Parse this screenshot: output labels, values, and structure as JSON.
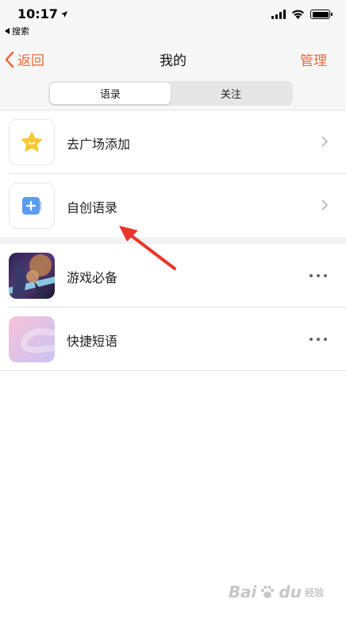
{
  "status_bar": {
    "time": "10:17",
    "back_app_label": "搜索"
  },
  "nav": {
    "back_label": "返回",
    "title": "我的",
    "manage_label": "管理"
  },
  "tabs": [
    {
      "label": "语录",
      "active": true
    },
    {
      "label": "关注",
      "active": false
    }
  ],
  "rows": [
    {
      "label": "去广场添加",
      "icon": "star-icon"
    },
    {
      "label": "自创语录",
      "icon": "plus-square-icon"
    },
    {
      "label": "游戏必备",
      "icon": "game-thumbnail"
    },
    {
      "label": "快捷短语",
      "icon": "gradient-thumbnail"
    }
  ],
  "watermark": {
    "brand": "Bai",
    "brand_end": "du",
    "sub": "经验"
  },
  "colors": {
    "accent": "#ec6a3d",
    "star": "#f6c832",
    "plus_tile": "#5b9cf0",
    "annotation": "#e8362a"
  }
}
